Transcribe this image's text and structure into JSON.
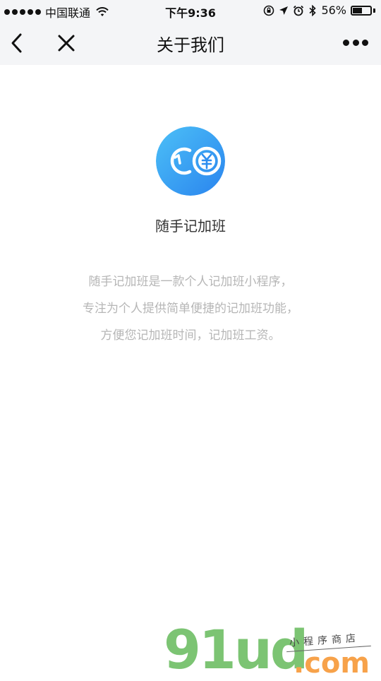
{
  "status_bar": {
    "signal_dots": 5,
    "carrier": "中国联通",
    "time": "下午9:36",
    "battery_text": "56%",
    "battery_level": 0.56
  },
  "nav": {
    "title": "关于我们",
    "back_icon": "chevron-left-icon",
    "close_icon": "close-icon",
    "more_icon": "more-dots-icon"
  },
  "app": {
    "name": "随手记加班",
    "logo_icon": "clock-yen-logo",
    "description_lines": [
      "随手记加班是一款个人记加班小程序，",
      "专注为个人提供简单便捷的记加班功能，",
      "方便您记加班时间，记加班工资。"
    ]
  },
  "watermark": {
    "brand": "91ud",
    "subtitle": "小程序商店",
    "domain": ".com"
  },
  "colors": {
    "bar_bg": "#f4f5f7",
    "logo_start": "#2f8ff0",
    "logo_end": "#48b8f5",
    "description": "#b6b6b6",
    "watermark_green": "#7cc473",
    "watermark_orange": "#f7a24a"
  }
}
